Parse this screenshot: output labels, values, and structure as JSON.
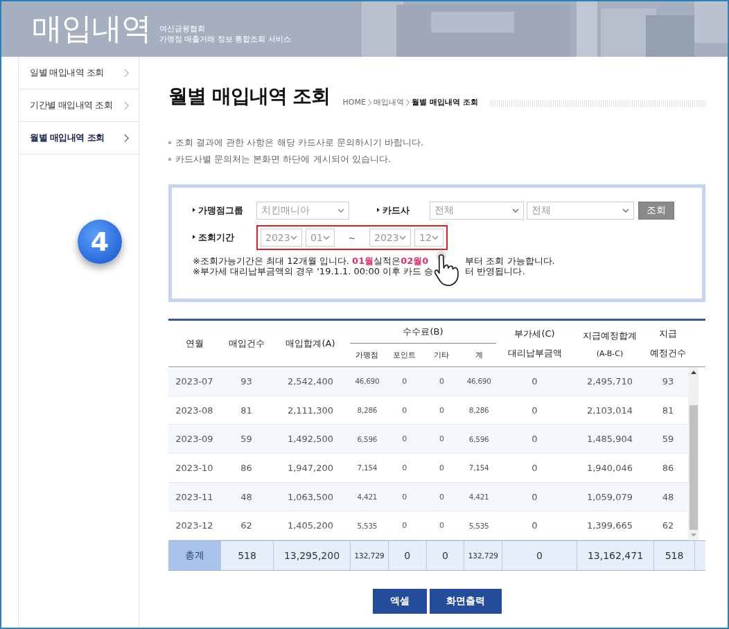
{
  "header": {
    "title": "매입내역",
    "subtitle_lines": [
      "여신금융협회",
      "가맹점 매출거래 정보 통합조회 서비스"
    ]
  },
  "sidebar": {
    "items": [
      {
        "label": "일별 매입내역 조회",
        "selected": false
      },
      {
        "label": "기간별 매입내역 조회",
        "selected": false
      },
      {
        "label": "월별 매입내역 조회",
        "selected": true
      }
    ]
  },
  "step_badge": "4",
  "page_title": "월별 매입내역 조회",
  "breadcrumb": [
    "HOME",
    "매입내역",
    "월별 매입내역 조회"
  ],
  "notices": [
    "조회 결과에 관한 사항은 해당 카드사로 문의하시기 바랍니다.",
    "카드사별 문의처는 본화면 하단에 게시되어 있습니다."
  ],
  "search": {
    "group": {
      "label": "가맹점그룹",
      "value": "치킨매니아"
    },
    "card": {
      "label": "카드사",
      "values": [
        "전체",
        "전체"
      ]
    },
    "submit": "조회",
    "period": {
      "label": "조회기간",
      "highlighted": true,
      "from_year": "2023",
      "from_month": "01",
      "separator": "~",
      "to_year": "2023",
      "to_month": "12"
    },
    "notes": [
      {
        "before": "※조회가능기간은 최대 12개월 입니다. **01월**실적은**02월0**",
        "after": "부터 조회 가능합니다."
      },
      {
        "before": "※부가세 대리납부금액의 경우 '19.1.1. 00:00 이후 카드 승",
        "after": "터 반영됩니다."
      }
    ]
  },
  "table": {
    "headers": {
      "month": "연월",
      "count": "매입건수",
      "total": "매입합계(A)",
      "fee": "수수료(B)",
      "fee_sub": [
        "가맹점",
        "포인트",
        "기타",
        "계"
      ],
      "vat": [
        "부가세(C)",
        "대리납부금액"
      ],
      "payout": [
        "지급예정합계",
        "(A-B-C)"
      ],
      "payout_count": [
        "지급",
        "예정건수"
      ]
    },
    "rows": [
      [
        "2023-07",
        "93",
        "2,542,400",
        "46,690",
        "0",
        "0",
        "46,690",
        "0",
        "2,495,710",
        "93"
      ],
      [
        "2023-08",
        "81",
        "2,111,300",
        "8,286",
        "0",
        "0",
        "8,286",
        "0",
        "2,103,014",
        "81"
      ],
      [
        "2023-09",
        "59",
        "1,492,500",
        "6,596",
        "0",
        "0",
        "6,596",
        "0",
        "1,485,904",
        "59"
      ],
      [
        "2023-10",
        "86",
        "1,947,200",
        "7,154",
        "0",
        "0",
        "7,154",
        "0",
        "1,940,046",
        "86"
      ],
      [
        "2023-11",
        "48",
        "1,063,500",
        "4,421",
        "0",
        "0",
        "4,421",
        "0",
        "1,059,079",
        "48"
      ],
      [
        "2023-12",
        "62",
        "1,405,200",
        "5,535",
        "0",
        "0",
        "5,535",
        "0",
        "1,399,665",
        "62"
      ]
    ],
    "total": [
      "총계",
      "518",
      "13,295,200",
      "132,729",
      "0",
      "0",
      "132,729",
      "0",
      "13,162,471",
      "518"
    ]
  },
  "buttons": [
    "엑셀",
    "화면출력"
  ]
}
